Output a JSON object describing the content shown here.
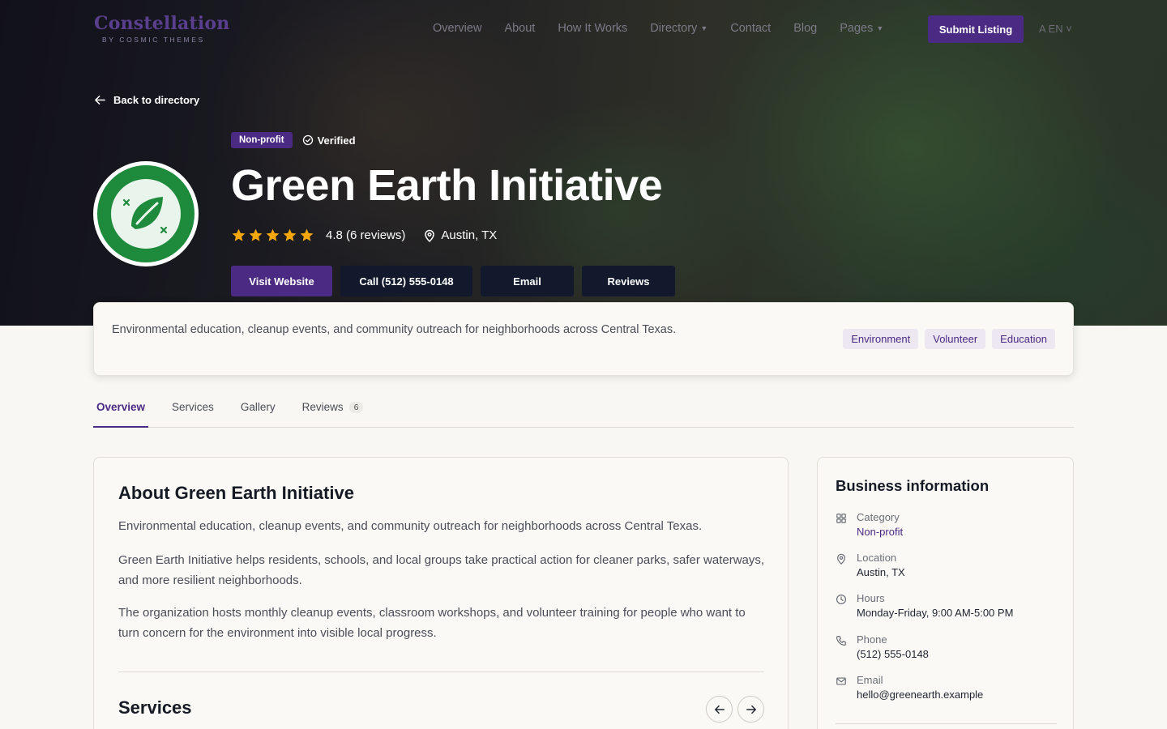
{
  "brand": {
    "name": "Constellation",
    "sub": "BY COSMIC THEMES"
  },
  "nav": {
    "items": [
      "Overview",
      "About",
      "How It Works",
      "Directory",
      "Contact",
      "Blog",
      "Pages"
    ],
    "submit_label": "Submit Listing",
    "lang": "EN"
  },
  "hero": {
    "back_label": "Back to directory",
    "category_badge": "Non-profit",
    "verified_label": "Verified",
    "title": "Green Earth Initiative",
    "rating": 4.8,
    "rating_text": "4.8 (6 reviews)",
    "location": "Austin, TX",
    "actions": {
      "website": "Visit Website",
      "call": "Call (512) 555-0148",
      "email": "Email",
      "reviews": "Reviews"
    }
  },
  "summary": {
    "text": "Environmental education, cleanup events, and community outreach for neighborhoods across Central Texas.",
    "tags": [
      "Environment",
      "Volunteer",
      "Education"
    ]
  },
  "tabs": {
    "overview": "Overview",
    "services": "Services",
    "gallery": "Gallery",
    "reviews": "Reviews",
    "reviews_count": "6"
  },
  "about": {
    "heading": "About Green Earth Initiative",
    "p1": "Environmental education, cleanup events, and community outreach for neighborhoods across Central Texas.",
    "p2": "Green Earth Initiative helps residents, schools, and local groups take practical action for cleaner parks, safer waterways, and more resilient neighborhoods.",
    "p3": "The organization hosts monthly cleanup events, classroom workshops, and volunteer training for people who want to turn concern for the environment into visible local progress.",
    "services_heading": "Services"
  },
  "business_info": {
    "heading": "Business information",
    "category_label": "Category",
    "category_value": "Non-profit",
    "location_label": "Location",
    "location_value": "Austin, TX",
    "hours_label": "Hours",
    "hours_value": "Monday-Friday, 9:00 AM-5:00 PM",
    "phone_label": "Phone",
    "phone_value": "(512) 555-0148",
    "email_label": "Email",
    "email_value": "hello@greenearth.example"
  },
  "colors": {
    "brand_purple": "#4b2a84",
    "navy": "#12192d",
    "star": "#f5a70c",
    "logo_green": "#1e8a3c"
  }
}
